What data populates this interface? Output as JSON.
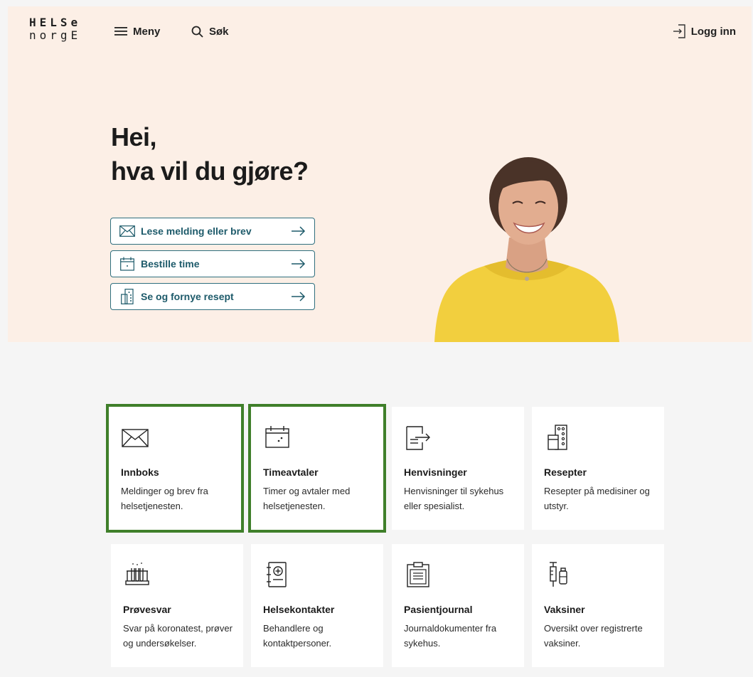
{
  "header": {
    "logo_line1": "HELSe",
    "logo_line2": "norgE",
    "menu_label": "Meny",
    "search_label": "Søk",
    "login_label": "Logg inn"
  },
  "hero": {
    "greeting_line1": "Hei,",
    "greeting_line2": "hva vil du gjøre?",
    "actions": [
      {
        "label": "Lese melding eller brev",
        "icon": "envelope-icon"
      },
      {
        "label": "Bestille time",
        "icon": "calendar-icon"
      },
      {
        "label": "Se og fornye resept",
        "icon": "prescription-icon"
      }
    ]
  },
  "cards": [
    {
      "title": "Innboks",
      "desc": "Meldinger og brev fra helsetjenesten.",
      "icon": "envelope-icon",
      "highlighted": true
    },
    {
      "title": "Timeavtaler",
      "desc": "Timer og avtaler med helsetjenesten.",
      "icon": "calendar-icon",
      "highlighted": true
    },
    {
      "title": "Henvisninger",
      "desc": "Henvisninger til sykehus eller spesialist.",
      "icon": "referral-document-icon",
      "highlighted": false
    },
    {
      "title": "Resepter",
      "desc": "Resepter på medisiner og utstyr.",
      "icon": "pill-box-icon",
      "highlighted": false
    },
    {
      "title": "Prøvesvar",
      "desc": "Svar på koronatest, prøver og undersøkelser.",
      "icon": "test-tubes-icon",
      "highlighted": false
    },
    {
      "title": "Helsekontakter",
      "desc": "Behandlere og kontaktpersoner.",
      "icon": "contact-book-icon",
      "highlighted": false
    },
    {
      "title": "Pasientjournal",
      "desc": "Journaldokumenter fra sykehus.",
      "icon": "clipboard-icon",
      "highlighted": false
    },
    {
      "title": "Vaksiner",
      "desc": "Oversikt over registrerte vaksiner.",
      "icon": "syringe-icon",
      "highlighted": false
    }
  ],
  "colors": {
    "hero_bg": "#fcefe6",
    "page_bg": "#f5f5f5",
    "action_text": "#1d5a6a",
    "highlight_outline": "#3f7f2a"
  }
}
